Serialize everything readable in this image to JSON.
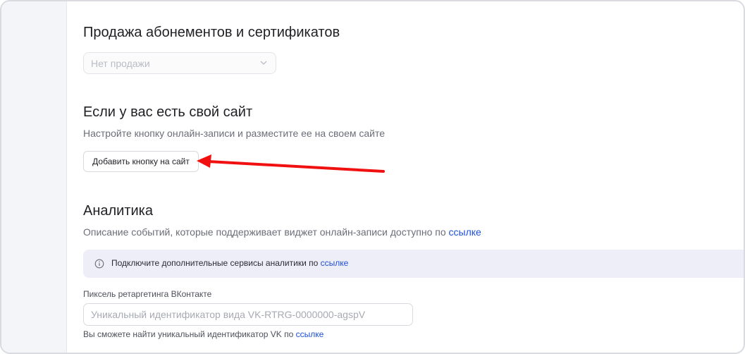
{
  "sales": {
    "title": "Продажа абонементов и сертификатов",
    "select_value": "Нет продажи"
  },
  "site": {
    "title": "Если у вас есть свой сайт",
    "description": "Настройте кнопку онлайн-записи и разместите ее на своем сайте",
    "button_label": "Добавить кнопку на сайт"
  },
  "analytics": {
    "title": "Аналитика",
    "description_prefix": "Описание событий, которые поддерживает виджет онлайн-записи доступно по ",
    "description_link": "ссылке",
    "info_text": "Подключите дополнительные сервисы аналитики по ",
    "info_link": "ссылке",
    "vk_label": "Пиксель ретаргетинга ВКонтакте",
    "vk_placeholder": "Уникальный идентификатор вида VK-RTRG-0000000-agspV",
    "vk_hint_prefix": "Вы сможете найти уникальный идентификатор VK по ",
    "vk_hint_link": "ссылке"
  },
  "colors": {
    "link": "#1d4fd8",
    "arrow": "#f01010",
    "info_bg": "#eeeef9"
  },
  "icons": [
    "chevron-down-icon",
    "info-icon",
    "annotation-arrow"
  ]
}
